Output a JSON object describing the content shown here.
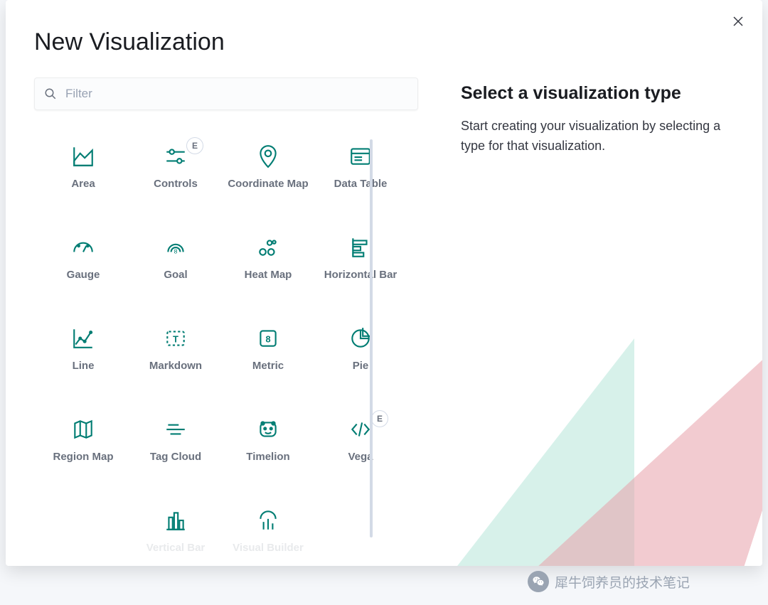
{
  "modal": {
    "title": "New Visualization",
    "close_aria": "Close"
  },
  "search": {
    "placeholder": "Filter"
  },
  "right": {
    "heading": "Select a visualization type",
    "description": "Start creating your visualization by selecting a type for that visualization."
  },
  "badge_text": "E",
  "viz_types": [
    {
      "id": "area",
      "label": "Area",
      "icon": "area",
      "badge": false
    },
    {
      "id": "controls",
      "label": "Controls",
      "icon": "controls",
      "badge": true
    },
    {
      "id": "coordinate-map",
      "label": "Coordinate Map",
      "icon": "coord-map",
      "badge": false
    },
    {
      "id": "data-table",
      "label": "Data Table",
      "icon": "data-table",
      "badge": false
    },
    {
      "id": "gauge",
      "label": "Gauge",
      "icon": "gauge",
      "badge": false
    },
    {
      "id": "goal",
      "label": "Goal",
      "icon": "goal",
      "badge": false
    },
    {
      "id": "heat-map",
      "label": "Heat Map",
      "icon": "heat-map",
      "badge": false
    },
    {
      "id": "horizontal-bar",
      "label": "Horizontal Bar",
      "icon": "h-bar",
      "badge": false
    },
    {
      "id": "line",
      "label": "Line",
      "icon": "line",
      "badge": false
    },
    {
      "id": "markdown",
      "label": "Markdown",
      "icon": "markdown",
      "badge": false
    },
    {
      "id": "metric",
      "label": "Metric",
      "icon": "metric",
      "badge": false
    },
    {
      "id": "pie",
      "label": "Pie",
      "icon": "pie",
      "badge": false
    },
    {
      "id": "region-map",
      "label": "Region Map",
      "icon": "region-map",
      "badge": false
    },
    {
      "id": "tag-cloud",
      "label": "Tag Cloud",
      "icon": "tag-cloud",
      "badge": false
    },
    {
      "id": "timelion",
      "label": "Timelion",
      "icon": "timelion",
      "badge": false
    },
    {
      "id": "vega",
      "label": "Vega",
      "icon": "vega",
      "badge": true
    },
    {
      "id": "vertical-bar",
      "label": "Vertical Bar",
      "icon": "v-bar",
      "badge": false
    },
    {
      "id": "visual-builder",
      "label": "Visual Builder",
      "icon": "vis-builder",
      "badge": false
    }
  ],
  "watermark": {
    "text": "犀牛饲养员的技术笔记"
  },
  "colors": {
    "accent": "#017d73"
  }
}
